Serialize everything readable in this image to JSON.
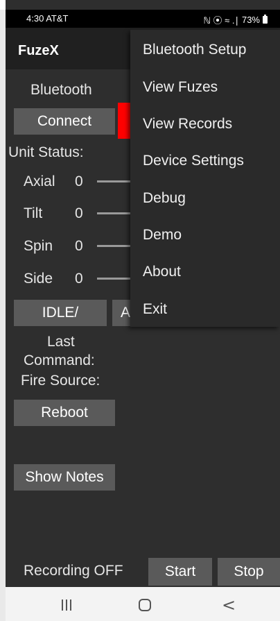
{
  "status_bar": {
    "time": "4:30 AT&T",
    "icons_text": "ℕ ⦿ ≈ .∣",
    "battery": "73%"
  },
  "app": {
    "title": "FuzeX"
  },
  "main": {
    "bluetooth_label": "Bluetooth",
    "connect_button": "Connect",
    "unit_status_label": "Unit Status:",
    "sensors": [
      {
        "name": "Axial",
        "value": "0"
      },
      {
        "name": "Tilt",
        "value": "0"
      },
      {
        "name": "Spin",
        "value": "0"
      },
      {
        "name": "Side",
        "value": "0"
      }
    ],
    "idle_button": "IDLE/",
    "arm_button_partial": "A",
    "last_command_label_1": "Last",
    "last_command_label_2": "Command:",
    "fire_source_label": "Fire Source:",
    "reboot_button": "Reboot",
    "show_notes_button": "Show Notes"
  },
  "recording": {
    "label": "Recording OFF",
    "start_button": "Start",
    "stop_button": "Stop"
  },
  "menu": {
    "items": [
      "Bluetooth Setup",
      "View Fuzes",
      "View Records",
      "Device Settings",
      "Debug",
      "Demo",
      "About",
      "Exit"
    ]
  },
  "navbar": {
    "recents_icon": "recents-icon",
    "home_icon": "home-icon",
    "back_icon": "back-icon",
    "back_glyph": "<"
  },
  "colors": {
    "background": "#2e2e2e",
    "appbar": "#202020",
    "button": "#5a5a5a",
    "indicator": "#ff0000",
    "menu": "#2a2a2a"
  }
}
